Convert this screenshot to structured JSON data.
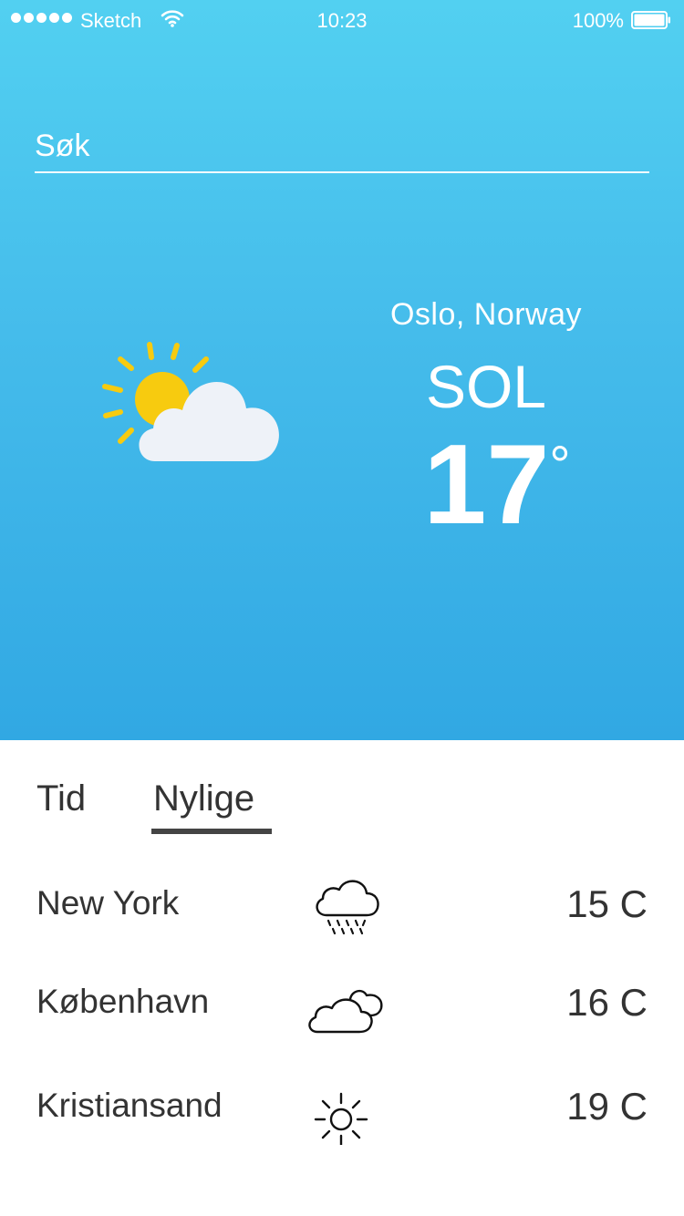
{
  "status_bar": {
    "carrier": "Sketch",
    "time": "10:23",
    "battery": "100%"
  },
  "search": {
    "placeholder": "Søk"
  },
  "current": {
    "location": "Oslo, Norway",
    "condition": "SOL",
    "temperature": "17",
    "degree_symbol": "°",
    "icon": "partly-sunny-icon"
  },
  "tabs": [
    {
      "label": "Tid",
      "active": false
    },
    {
      "label": "Nylige",
      "active": true
    }
  ],
  "recent": [
    {
      "city": "New York",
      "icon": "rain-cloud-icon",
      "temp": "15 C"
    },
    {
      "city": "København",
      "icon": "cloudy-icon",
      "temp": "16 C"
    },
    {
      "city": "Kristiansand",
      "icon": "sun-icon",
      "temp": "19 C"
    }
  ],
  "colors": {
    "sky_top": "#52d0f1",
    "sky_bottom": "#31a8e3",
    "sun": "#f7cb0f",
    "cloud": "#eef2f8",
    "text_dark": "#333333"
  }
}
